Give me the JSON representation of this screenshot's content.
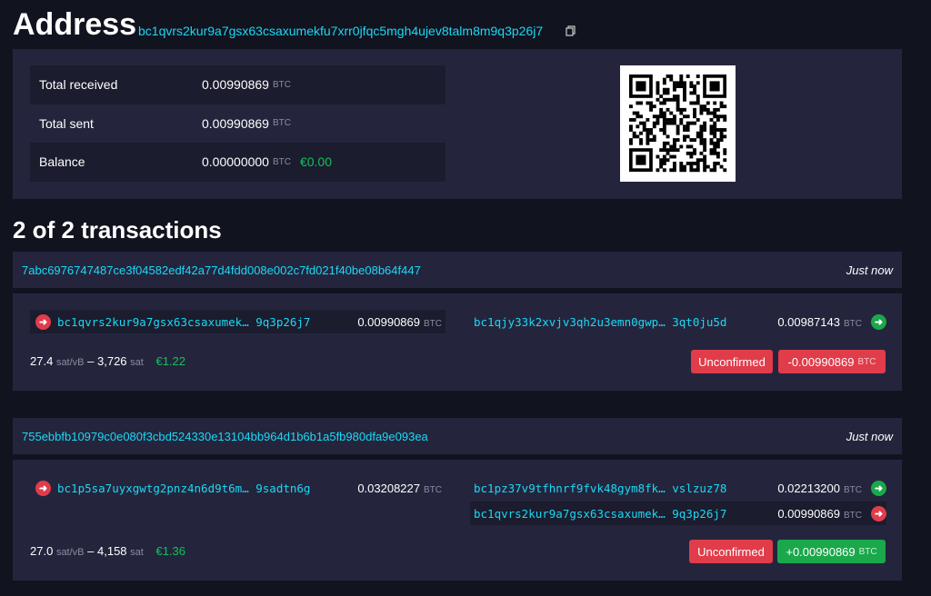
{
  "page": {
    "title": "Address",
    "address": "bc1qvrs2kur9a7gsx63csaxumekfu7xrr0jfqc5mgh4ujev8talm8m9q3p26j7",
    "copy_icon": "copy-icon"
  },
  "stats": {
    "total_received_label": "Total received",
    "total_received_value": "0.00990869",
    "total_sent_label": "Total sent",
    "total_sent_value": "0.00990869",
    "balance_label": "Balance",
    "balance_value": "0.00000000",
    "balance_fiat": "€0.00",
    "unit": "BTC"
  },
  "transactions_heading": "2 of 2 transactions",
  "transactions": [
    {
      "txid": "7abc6976747487ce3f04582edf42a77d4fdd008e002c7fd021f40be08b64f447",
      "time": "Just now",
      "inputs": [
        {
          "address_start": "bc1qvrs2kur9a7gsx63csaxumek…",
          "address_end": "9q3p26j7",
          "amount": "0.00990869",
          "unit": "BTC"
        }
      ],
      "outputs": [
        {
          "address_start": "bc1qjy33k2xvjv3qh2u3emn0gwp…",
          "address_end": "3qt0ju5d",
          "amount": "0.00987143",
          "unit": "BTC"
        }
      ],
      "fee_rate": "27.4",
      "fee_rate_unit": "sat/vB",
      "fee_sep": "–",
      "fee_sat": "3,726",
      "fee_unit": "sat",
      "fee_fiat": "€1.22",
      "status": "Unconfirmed",
      "delta": "-0.00990869",
      "delta_unit": "BTC"
    },
    {
      "txid": "755ebbfb10979c0e080f3cbd524330e13104bb964d1b6b1a5fb980dfa9e093ea",
      "time": "Just now",
      "inputs": [
        {
          "address_start": "bc1p5sa7uyxgwtg2pnz4n6d9t6m…",
          "address_end": "9sadtn6g",
          "amount": "0.03208227",
          "unit": "BTC"
        }
      ],
      "outputs": [
        {
          "address_start": "bc1pz37v9tfhnrf9fvk48gym8fk…",
          "address_end": "vslzuz78",
          "amount": "0.02213200",
          "unit": "BTC"
        },
        {
          "address_start": "bc1qvrs2kur9a7gsx63csaxumek…",
          "address_end": "9q3p26j7",
          "amount": "0.00990869",
          "unit": "BTC"
        }
      ],
      "fee_rate": "27.0",
      "fee_rate_unit": "sat/vB",
      "fee_sep": "–",
      "fee_sat": "4,158",
      "fee_unit": "sat",
      "fee_fiat": "€1.36",
      "status": "Unconfirmed",
      "delta": "+0.00990869",
      "delta_unit": "BTC"
    }
  ],
  "colors": {
    "background": "#11131f",
    "panel": "#24253d",
    "link": "#1bd8f4",
    "green": "#1aa84a",
    "red": "#e13c4a"
  }
}
